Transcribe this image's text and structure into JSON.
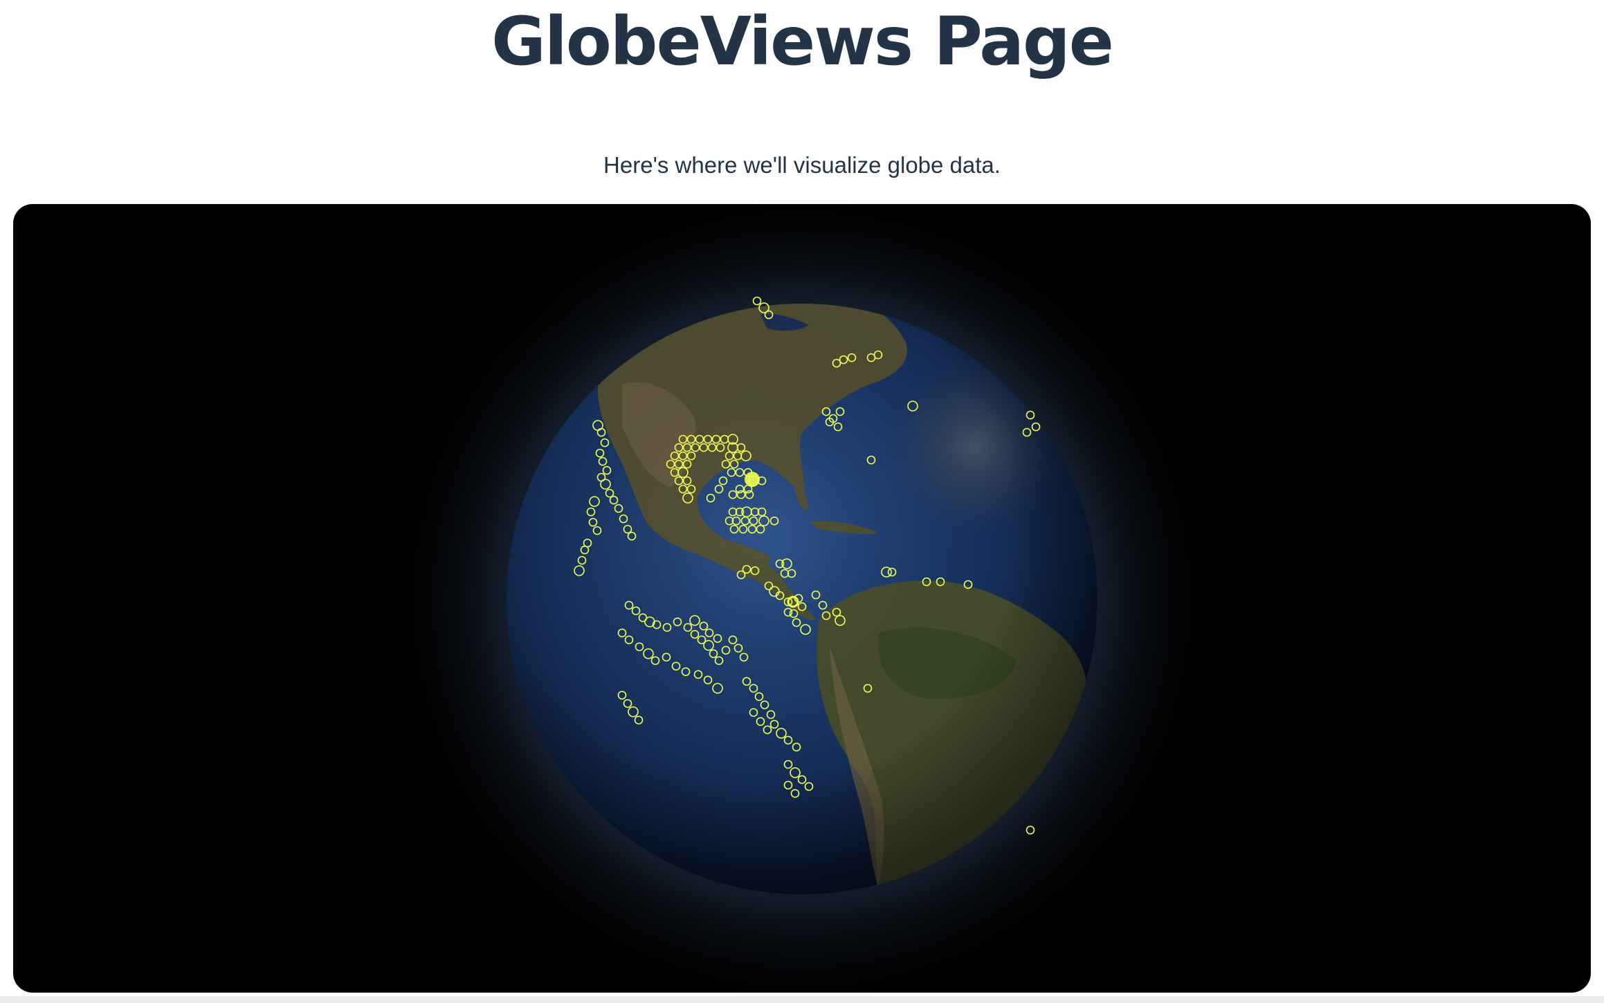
{
  "page": {
    "title": "GlobeViews Page",
    "subtitle": "Here's where we'll visualize globe data."
  },
  "globe": {
    "background_color": "#000000",
    "ocean_color": "#17305c",
    "land_color": "#4a4a2e",
    "atmosphere_color": "#5f86b3",
    "marker_color": "#f2ff4d",
    "marker_style": "hollow-circle"
  }
}
